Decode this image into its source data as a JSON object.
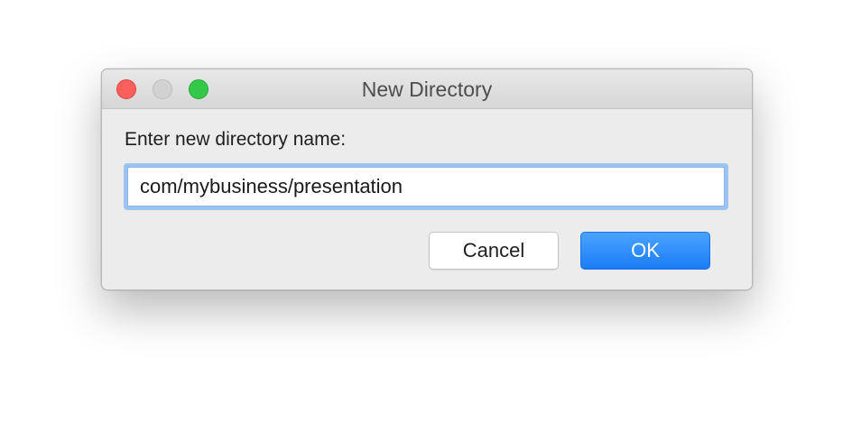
{
  "dialog": {
    "title": "New Directory",
    "prompt_label": "Enter new directory name:",
    "input_value": "com/mybusiness/presentation",
    "buttons": {
      "cancel_label": "Cancel",
      "ok_label": "OK"
    }
  },
  "window_controls": [
    "close",
    "minimize",
    "zoom"
  ],
  "colors": {
    "close": "#fc605c",
    "minimize": "#d2d2d2",
    "zoom": "#34c84a",
    "focus_ring": "#9cc4f3",
    "primary_button": "#1b7cf5"
  }
}
